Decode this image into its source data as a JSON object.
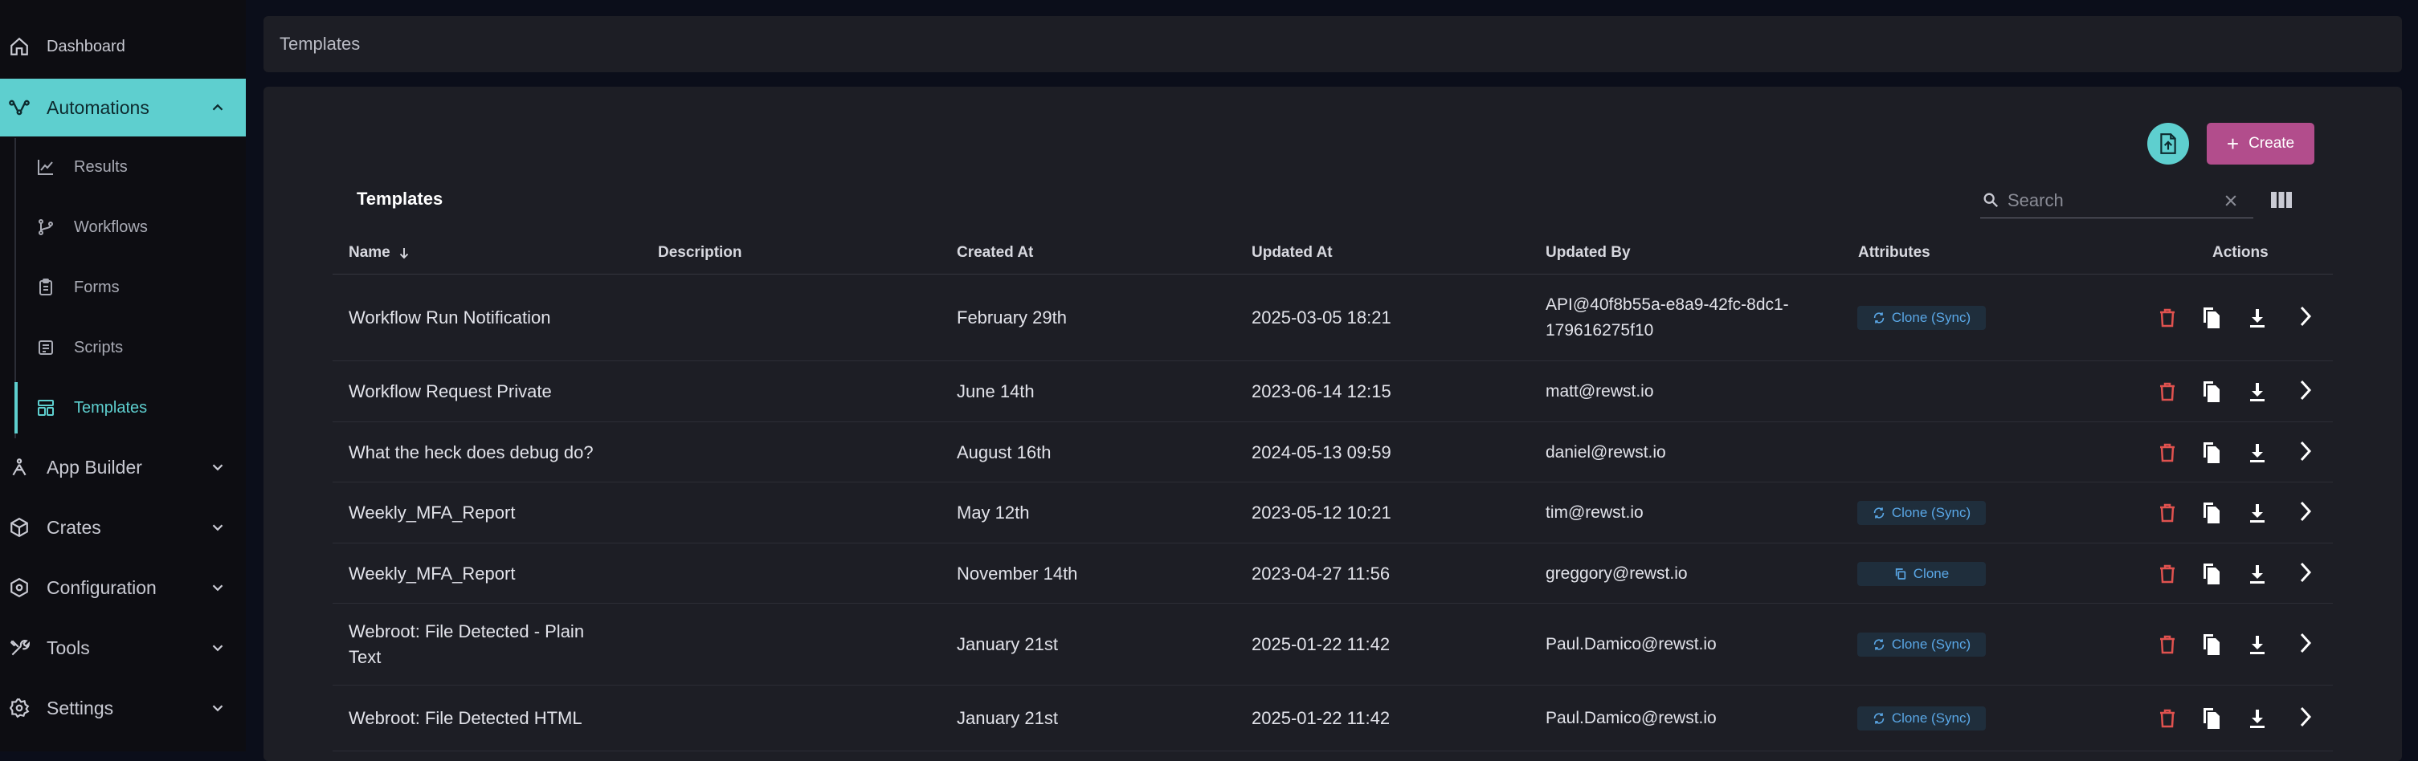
{
  "sidebar": {
    "items": [
      {
        "label": "Dashboard"
      },
      {
        "label": "Automations"
      },
      {
        "label": "App Builder"
      },
      {
        "label": "Crates"
      },
      {
        "label": "Configuration"
      },
      {
        "label": "Tools"
      },
      {
        "label": "Settings"
      }
    ],
    "subitems": [
      {
        "label": "Results"
      },
      {
        "label": "Workflows"
      },
      {
        "label": "Forms"
      },
      {
        "label": "Scripts"
      },
      {
        "label": "Templates"
      }
    ],
    "active_item": "Automations",
    "active_subitem": "Templates"
  },
  "breadcrumb": {
    "title": "Templates"
  },
  "toolbar": {
    "create_label": "Create"
  },
  "table": {
    "title": "Templates",
    "search_placeholder": "Search",
    "columns": [
      "Name",
      "Description",
      "Created At",
      "Updated At",
      "Updated By",
      "Attributes",
      "Actions"
    ],
    "rows": [
      {
        "name": "Workflow Run Notification",
        "name2": "",
        "description": "",
        "created_at": "February 29th",
        "updated_at": "2025-03-05 18:21",
        "updated_by": "API@40f8b55a-e8a9-42fc-8dc1-",
        "updated_by2": "179616275f10",
        "attribute": "Clone (Sync)"
      },
      {
        "name": "Workflow Request Private",
        "name2": "",
        "description": "",
        "created_at": "June 14th",
        "updated_at": "2023-06-14 12:15",
        "updated_by": "matt@rewst.io",
        "updated_by2": "",
        "attribute": ""
      },
      {
        "name": "What the heck does debug do?",
        "name2": "",
        "description": "",
        "created_at": "August 16th",
        "updated_at": "2024-05-13 09:59",
        "updated_by": "daniel@rewst.io",
        "updated_by2": "",
        "attribute": ""
      },
      {
        "name": "Weekly_MFA_Report",
        "name2": "",
        "description": "",
        "created_at": "May 12th",
        "updated_at": "2023-05-12 10:21",
        "updated_by": "tim@rewst.io",
        "updated_by2": "",
        "attribute": "Clone (Sync)"
      },
      {
        "name": "Weekly_MFA_Report",
        "name2": "",
        "description": "",
        "created_at": "November 14th",
        "updated_at": "2023-04-27 11:56",
        "updated_by": "greggory@rewst.io",
        "updated_by2": "",
        "attribute": "Clone"
      },
      {
        "name": "Webroot: File Detected - Plain",
        "name2": "Text",
        "description": "",
        "created_at": "January 21st",
        "updated_at": "2025-01-22 11:42",
        "updated_by": "Paul.Damico@rewst.io",
        "updated_by2": "",
        "attribute": "Clone (Sync)"
      },
      {
        "name": "Webroot: File Detected HTML",
        "name2": "",
        "description": "",
        "created_at": "January 21st",
        "updated_at": "2025-01-22 11:42",
        "updated_by": "Paul.Damico@rewst.io",
        "updated_by2": "",
        "attribute": "Clone (Sync)"
      }
    ]
  },
  "colors": {
    "accent": "#5ecfcf",
    "create": "#b24d8c",
    "delete": "#e0524f",
    "badge_text": "#5aa7e6"
  }
}
